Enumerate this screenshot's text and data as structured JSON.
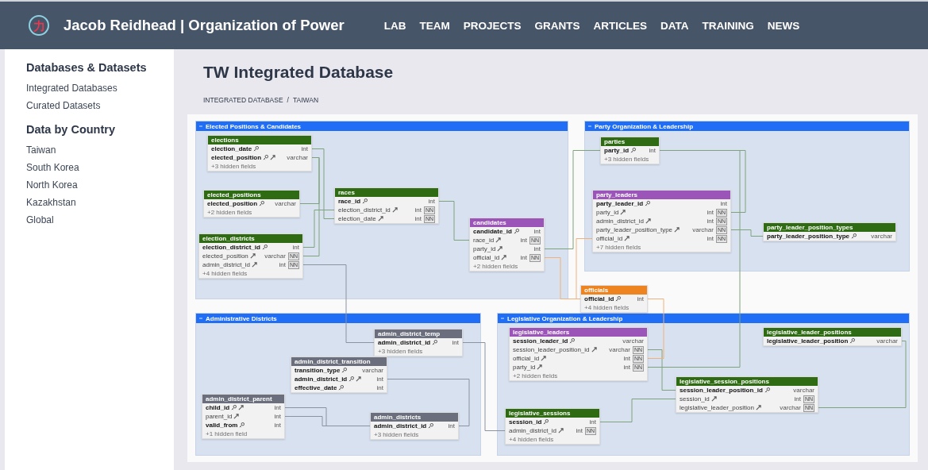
{
  "header": {
    "logo": "力",
    "title": "Jacob Reidhead | Organization of Power",
    "nav": [
      "LAB",
      "TEAM",
      "PROJECTS",
      "GRANTS",
      "ARTICLES",
      "DATA",
      "TRAINING",
      "NEWS"
    ]
  },
  "sidebar": {
    "sections": [
      {
        "heading": "Databases & Datasets",
        "items": [
          "Integrated Databases",
          "Curated Datasets"
        ]
      },
      {
        "heading": "Data by Country",
        "items": [
          "Taiwan",
          "South Korea",
          "North Korea",
          "Kazakhstan",
          "Global"
        ]
      }
    ]
  },
  "main": {
    "title": "TW Integrated Database",
    "breadcrumb": [
      "INTEGRATED DATABASE",
      "TAIWAN"
    ],
    "breadcrumb_separator": "/"
  },
  "diagram": {
    "groups": [
      {
        "title": "Elected Positions & Candidates",
        "tables": [
          {
            "name": "elections",
            "color": "#2e6b12",
            "fields": [
              {
                "name": "election_date",
                "type": "int",
                "pk": true,
                "fk": false
              },
              {
                "name": "elected_position",
                "type": "varchar",
                "pk": true,
                "fk": true
              }
            ],
            "hidden": "+3 hidden fields"
          },
          {
            "name": "elected_positions",
            "color": "#2e6b12",
            "fields": [
              {
                "name": "elected_position",
                "type": "varchar",
                "pk": true,
                "fk": false
              }
            ],
            "hidden": "+2 hidden fields"
          },
          {
            "name": "election_districts",
            "color": "#2e6b12",
            "fields": [
              {
                "name": "election_district_id",
                "type": "int",
                "pk": true,
                "fk": false
              },
              {
                "name": "elected_position",
                "type": "varchar",
                "pk": false,
                "fk": true,
                "badge": "NN"
              },
              {
                "name": "admin_district_id",
                "type": "int",
                "pk": false,
                "fk": true,
                "badge": "NN"
              }
            ],
            "hidden": "+4 hidden fields"
          },
          {
            "name": "races",
            "color": "#2e6b12",
            "fields": [
              {
                "name": "race_id",
                "type": "int",
                "pk": true,
                "fk": false
              },
              {
                "name": "election_district_id",
                "type": "int",
                "pk": false,
                "fk": true,
                "badge": "NN"
              },
              {
                "name": "election_date",
                "type": "int",
                "pk": false,
                "fk": true,
                "badge": "NN"
              }
            ]
          },
          {
            "name": "candidates",
            "color": "#9b55b8",
            "fields": [
              {
                "name": "candidate_id",
                "type": "int",
                "pk": true,
                "fk": false
              },
              {
                "name": "race_id",
                "type": "int",
                "pk": false,
                "fk": true,
                "badge": "NN"
              },
              {
                "name": "party_id",
                "type": "int",
                "pk": false,
                "fk": true
              },
              {
                "name": "official_id",
                "type": "int",
                "pk": false,
                "fk": true,
                "badge": "NN"
              }
            ],
            "hidden": "+2 hidden fields"
          }
        ]
      },
      {
        "title": "Party Organization & Leadership",
        "tables": [
          {
            "name": "parties",
            "color": "#2e6b12",
            "fields": [
              {
                "name": "party_id",
                "type": "int",
                "pk": true,
                "fk": false
              }
            ],
            "hidden": "+3 hidden fields"
          },
          {
            "name": "party_leaders",
            "color": "#9b55b8",
            "fields": [
              {
                "name": "party_leader_id",
                "type": "int",
                "pk": true,
                "fk": false
              },
              {
                "name": "party_id",
                "type": "int",
                "pk": false,
                "fk": true,
                "badge": "NN"
              },
              {
                "name": "admin_district_id",
                "type": "int",
                "pk": false,
                "fk": true,
                "badge": "NN"
              },
              {
                "name": "party_leader_position_type",
                "type": "varchar",
                "pk": false,
                "fk": true,
                "badge": "NN"
              },
              {
                "name": "official_id",
                "type": "int",
                "pk": false,
                "fk": true,
                "badge": "NN"
              }
            ],
            "hidden": "+7 hidden fields"
          },
          {
            "name": "party_leader_position_types",
            "color": "#2e6b12",
            "fields": [
              {
                "name": "party_leader_position_type",
                "type": "varchar",
                "pk": true,
                "fk": false
              }
            ]
          }
        ]
      },
      {
        "title": "Administrative Districts",
        "tables": [
          {
            "name": "admin_district_temp",
            "color": "#6b6f7d",
            "fields": [
              {
                "name": "admin_district_id",
                "type": "int",
                "pk": true,
                "fk": false
              }
            ],
            "hidden": "+3 hidden fields"
          },
          {
            "name": "admin_district_transition",
            "color": "#6b6f7d",
            "fields": [
              {
                "name": "transition_type",
                "type": "varchar",
                "pk": true,
                "fk": false
              },
              {
                "name": "admin_district_id",
                "type": "int",
                "pk": true,
                "fk": true
              },
              {
                "name": "effective_date",
                "type": "int",
                "pk": true,
                "fk": false
              }
            ]
          },
          {
            "name": "admin_district_parent",
            "color": "#6b6f7d",
            "fields": [
              {
                "name": "child_id",
                "type": "int",
                "pk": true,
                "fk": true
              },
              {
                "name": "parent_id",
                "type": "int",
                "pk": false,
                "fk": true
              },
              {
                "name": "valid_from",
                "type": "int",
                "pk": true,
                "fk": false
              }
            ],
            "hidden": "+1 hidden field"
          },
          {
            "name": "admin_districts",
            "color": "#6b6f7d",
            "fields": [
              {
                "name": "admin_district_id",
                "type": "int",
                "pk": true,
                "fk": false
              }
            ],
            "hidden": "+3 hidden fields"
          }
        ]
      },
      {
        "title": "Legislative Organization & Leadership",
        "tables": [
          {
            "name": "legislative_leaders",
            "color": "#9b55b8",
            "fields": [
              {
                "name": "session_leader_id",
                "type": "varchar",
                "pk": true,
                "fk": false
              },
              {
                "name": "session_leader_position_id",
                "type": "varchar",
                "pk": false,
                "fk": true,
                "badge": "NN"
              },
              {
                "name": "official_id",
                "type": "int",
                "pk": false,
                "fk": true,
                "badge": "NN"
              },
              {
                "name": "party_id",
                "type": "int",
                "pk": false,
                "fk": true,
                "badge": "NN"
              }
            ],
            "hidden": "+2 hidden fields"
          },
          {
            "name": "legislative_session_positions",
            "color": "#2e6b12",
            "fields": [
              {
                "name": "session_leader_position_id",
                "type": "varchar",
                "pk": true,
                "fk": false
              },
              {
                "name": "session_id",
                "type": "int",
                "pk": false,
                "fk": true,
                "badge": "NN"
              },
              {
                "name": "legislative_leader_position",
                "type": "varchar",
                "pk": false,
                "fk": true,
                "badge": "NN"
              }
            ]
          },
          {
            "name": "legislative_leader_positions",
            "color": "#2e6b12",
            "fields": [
              {
                "name": "legislative_leader_position",
                "type": "varchar",
                "pk": true,
                "fk": false
              }
            ]
          },
          {
            "name": "legislative_sessions",
            "color": "#2e6b12",
            "fields": [
              {
                "name": "session_id",
                "type": "int",
                "pk": true,
                "fk": false
              },
              {
                "name": "admin_district_id",
                "type": "int",
                "pk": false,
                "fk": true,
                "badge": "NN"
              }
            ],
            "hidden": "+4 hidden fields"
          }
        ]
      }
    ],
    "tables": [
      {
        "name": "officials",
        "color": "#ee8420",
        "fields": [
          {
            "name": "official_id",
            "type": "int",
            "pk": true,
            "fk": false
          }
        ],
        "hidden": "+4 hidden fields"
      }
    ]
  }
}
